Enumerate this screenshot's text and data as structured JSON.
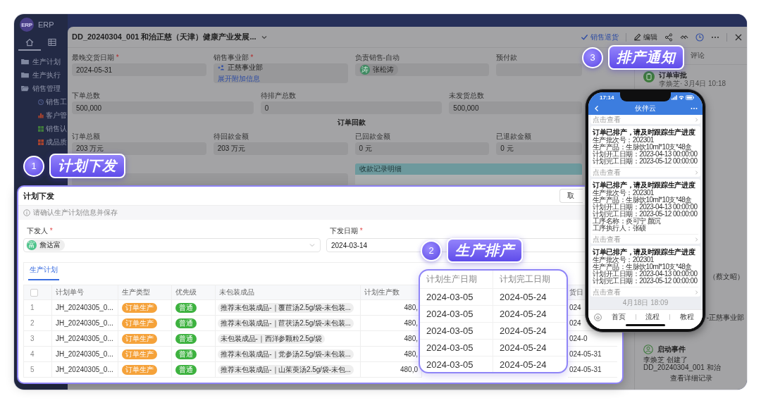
{
  "app": {
    "logo_text": "ERP",
    "name": "ERP",
    "nav_tabs": [
      {
        "kind": "home",
        "selected": true
      },
      {
        "kind": "grid",
        "selected": false
      }
    ],
    "sidebar": {
      "items": [
        {
          "label": "生产计划",
          "expanded": false
        },
        {
          "label": "生产执行",
          "expanded": false
        },
        {
          "label": "销售管理",
          "expanded": true,
          "children": [
            {
              "label": "销售工",
              "kind": "clock",
              "color": "#4a5683"
            },
            {
              "label": "客户管",
              "kind": "chart",
              "color": "#a9432e"
            },
            {
              "label": "销售认",
              "kind": "grid",
              "color": "#3f7a3b"
            },
            {
              "label": "成品质",
              "kind": "grid",
              "color": "#a9432e"
            }
          ]
        }
      ]
    }
  },
  "drawer": {
    "title": "DD_20240304_001 和治正慈（天津）健康产业发展...",
    "actions": [
      {
        "kind": "check",
        "label": "销售退货"
      },
      {
        "kind": "edit",
        "label": "编辑"
      }
    ],
    "tools": [
      {
        "kind": "share",
        "selected": false
      },
      {
        "kind": "link",
        "selected": false
      },
      {
        "kind": "history",
        "selected": true
      },
      {
        "kind": "more",
        "selected": false
      },
      {
        "kind": "close",
        "selected": false
      }
    ],
    "sections": [
      {
        "rows": [
          [
            {
              "label": "最晚交货日期",
              "required_mark": "*",
              "value": "2024-05-31"
            },
            {
              "label": "销售事业部",
              "required_mark": "*",
              "kind": "department",
              "value": "正慈事业部",
              "link": "展开附加信息"
            },
            {
              "label": "负责销售-自动",
              "kind": "person",
              "avatar": "涛",
              "value": "张松涛"
            },
            {
              "label": "预付款"
            }
          ],
          [
            {
              "label": "下单总数",
              "value": "500,000"
            },
            {
              "label": "待排产总数",
              "value": "0"
            },
            {
              "label": "未发货总数",
              "value": "500,000"
            }
          ]
        ]
      },
      {
        "title": "订单回款",
        "rows": [
          [
            {
              "label": "订单总额",
              "value": "203 万元"
            },
            {
              "label": "待回款金额",
              "value": "203 万元"
            },
            {
              "label": "已回款金额",
              "value": "0 元"
            },
            {
              "label": "已退款金额",
              "value": "0 元"
            }
          ]
        ]
      }
    ],
    "subtable": {
      "title": "收款记录明细"
    },
    "panel": {
      "tabs": [
        {
          "label": "评论",
          "selected": false
        }
      ],
      "activities": [
        {
          "kind": "approval",
          "title": "订单审批",
          "meta": "李焕芝· 3月4日 10:18"
        },
        {
          "kind": "text",
          "title": "（蔡文昭）"
        },
        {
          "kind": "text",
          "title": "-正慈事业部"
        },
        {
          "kind": "start",
          "title": "启动事件",
          "meta": "李焕芝 创建了 DD_20240304_001 和治"
        }
      ],
      "more_link": "查看详细记录"
    }
  },
  "dialog": {
    "title": "计划下发",
    "cancel_button": "取",
    "notice": "请确认生产计划信息并保存",
    "form": [
      {
        "label": "下发人",
        "required_mark": "*",
        "kind": "person",
        "avatar": "富",
        "value": "詹达富"
      },
      {
        "label": "下发日期",
        "required_mark": "*",
        "kind": "date",
        "value": "2024-03-14"
      }
    ],
    "tabs": [
      {
        "label": "生产计划",
        "selected": true
      }
    ],
    "table": {
      "select_all": {
        "checked": false
      },
      "columns": [
        {
          "label": "计划单号",
          "kind": "text"
        },
        {
          "label": "生产类型",
          "kind": "tag",
          "color": "#f5a23a"
        },
        {
          "label": "优先级",
          "kind": "tag",
          "color": "#3db23f"
        },
        {
          "label": "未包装成品",
          "kind": "chip"
        },
        {
          "label": "计划生产数",
          "kind": "number"
        },
        {
          "label": "货日",
          "kind": "text"
        }
      ],
      "rows": [
        {
          "number": "1",
          "cells": [
            "JH_20240305_0...",
            "订单生产",
            "普通",
            "推荐未包装成品-｜覆苣汤2.5g/袋-未包装...",
            "480,",
            "024"
          ]
        },
        {
          "number": "2",
          "cells": [
            "JH_20240305_0...",
            "订单生产",
            "普通",
            "推荐未包装成品-｜苣茯汤2.5g/袋-未包装...",
            "480,",
            "024"
          ]
        },
        {
          "number": "3",
          "cells": [
            "JH_20240305_0...",
            "订单生产",
            "普通",
            "未包装成品-｜西洋参颗粒2.5g/袋",
            "480,",
            "024-0"
          ]
        },
        {
          "number": "4",
          "cells": [
            "JH_20240305_0...",
            "订单生产",
            "普通",
            "推荐未包装成品-｜党参汤2.5g/袋-未包装...",
            "480,",
            "024-05-31"
          ]
        },
        {
          "number": "5",
          "cells": [
            "JH_20240305_0...",
            "订单生产",
            "普通",
            "推荐未包装成品-｜山茱萸汤2.5g/袋-未包...",
            "480,0",
            "024-05-31"
          ]
        }
      ]
    }
  },
  "schedule_detail": {
    "columns": [
      "计划生产日期",
      "计划完工日期"
    ],
    "rows": [
      [
        "2024-03-05",
        "2024-05-24"
      ],
      [
        "2024-03-05",
        "2024-05-24"
      ],
      [
        "2024-03-05",
        "2024-05-24"
      ],
      [
        "2024-03-05",
        "2024-05-24"
      ],
      [
        "2024-03-05",
        "2024-05-24"
      ]
    ]
  },
  "callouts": [
    {
      "number": "1",
      "label": "计划下发"
    },
    {
      "number": "2",
      "label": "生产排产"
    },
    {
      "number": "3",
      "label": "排产通知"
    }
  ],
  "phone": {
    "time": "17:14",
    "title": "伙伴云",
    "top_link": "点击查看",
    "messages": [
      {
        "title": "订单已排产，请及时跟踪生产进度",
        "lines": [
          "生产批次号：202301",
          "生产产品：生脉饮10ml*10支*48盒",
          "计划开工日期：2023-04-13 00:00:00",
          "计划完工日期：2023-05-12 00:00:00"
        ],
        "link": "点击查看"
      },
      {
        "title": "订单已排产，请及时跟踪生产进度",
        "lines": [
          "生产批次号：202301",
          "生产产品：生脉饮10ml*10支*48盒",
          "计划开工日期：2023-04-13 00:00:00",
          "计划完工日期：2023-05-12 00:00:00",
          "工序名称：炎可宁 颜沉",
          "工序执行人：张硕"
        ],
        "link": "点击查看"
      },
      {
        "title": "订单已排产，请及时跟踪生产进度",
        "lines": [
          "生产批次号：202301",
          "生产产品：生脉饮10ml*10支*48盒",
          "计划开工日期：2023-04-13 00:00:00",
          "计划完工日期：2023-05-12 00:00:00"
        ],
        "link": "点击查看"
      }
    ],
    "timestamp": "4月18日 18:09",
    "tabs": [
      "首页",
      "流程",
      "教程"
    ]
  }
}
